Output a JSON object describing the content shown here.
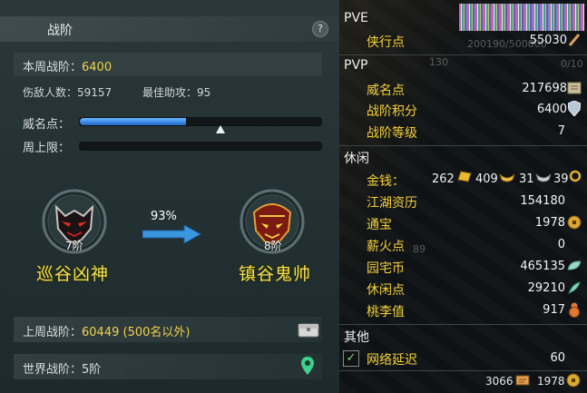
{
  "left_panel": {
    "title": "战阶",
    "help_icon": "?",
    "weekly_rank_label": "本周战阶：",
    "weekly_rank_value": "6400",
    "kills_label": "伤敌人数：",
    "kills_value": "59157",
    "assist_label": "最佳助攻：",
    "assist_value": "95",
    "prestige_label": "威名点：",
    "prestige_fill_fraction": 0.44,
    "weekly_cap_label": "周上限：",
    "weekly_cap_fill_fraction": 0,
    "current_rank": {
      "level": "7阶",
      "name": "巡谷凶神"
    },
    "progress_percent": "93%",
    "next_rank": {
      "level": "8阶",
      "name": "镇谷鬼帅"
    },
    "last_week_label": "上周战阶：",
    "last_week_value": "60449 (500名以外)",
    "world_rank_label": "世界战阶：",
    "world_rank_value": "5阶"
  },
  "right_panel": {
    "pve": {
      "header": "PVE",
      "rows": [
        {
          "label": "侠行点",
          "value": "55030",
          "icon": "sword-icon"
        }
      ]
    },
    "pvp": {
      "header": "PVP",
      "rows": [
        {
          "label": "威名点",
          "value": "217698",
          "icon": "banner-icon"
        },
        {
          "label": "战阶积分",
          "value": "6400",
          "icon": "shield-icon"
        },
        {
          "label": "战阶等级",
          "value": "7"
        }
      ]
    },
    "leisure": {
      "header": "休闲",
      "money_label": "金钱：",
      "money_gold": "262",
      "money_silver": "409",
      "money_copper": "31",
      "money_iron": "39",
      "rows": [
        {
          "label": "江湖资历",
          "value": "154180"
        },
        {
          "label": "通宝",
          "value": "1978",
          "icon": "coin-icon"
        },
        {
          "label": "薪火点",
          "value": "0"
        },
        {
          "label": "园宅币",
          "value": "465135",
          "icon": "leaf-icon"
        },
        {
          "label": "休闲点",
          "value": "29210",
          "icon": "feather-icon"
        },
        {
          "label": "桃李值",
          "value": "917",
          "icon": "gourd-icon"
        }
      ]
    },
    "other": {
      "header": "其他",
      "latency_label": "网络延迟",
      "latency_value": "60"
    },
    "footer": {
      "left_value": "3066",
      "right_value": "1978"
    }
  },
  "background_text": {
    "t1": "200190/500000",
    "t2": "130",
    "t3": "0/10",
    "t4": "89"
  },
  "colors": {
    "accent_yellow": "#f0d44a",
    "label_gold": "#f4d13a",
    "bar_blue": "#2f8ae6"
  }
}
